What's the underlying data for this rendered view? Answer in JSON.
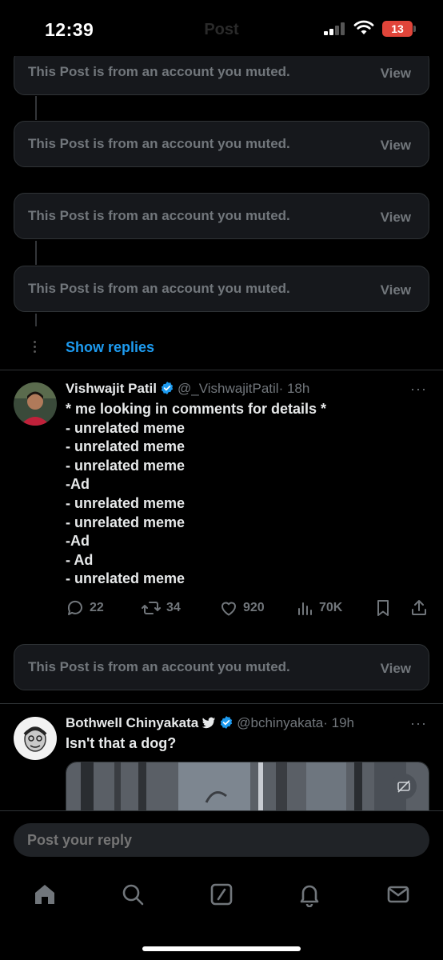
{
  "status_bar": {
    "time": "12:39",
    "title": "Post",
    "battery": "13"
  },
  "muted_cards": [
    {
      "text": "This Post is from an account you muted.",
      "view_label": "View"
    },
    {
      "text": "This Post is from an account you muted.",
      "view_label": "View"
    },
    {
      "text": "This Post is from an account you muted.",
      "view_label": "View"
    },
    {
      "text": "This Post is from an account you muted.",
      "view_label": "View"
    },
    {
      "text": "This Post is from an account you muted.",
      "view_label": "View"
    }
  ],
  "show_replies": "Show replies",
  "tweets": [
    {
      "name": "Vishwajit Patil",
      "handle": "@_VishwajitPatil",
      "time": "· 18h",
      "lines": [
        "* me looking in comments for details *",
        "- unrelated meme",
        "- unrelated meme",
        "- unrelated meme",
        "-Ad",
        "- unrelated meme",
        "- unrelated meme",
        "-Ad",
        "- Ad",
        "- unrelated meme"
      ],
      "stats": {
        "replies": "22",
        "reposts": "34",
        "likes": "920",
        "views": "70K"
      }
    },
    {
      "name": "Bothwell Chinyakata",
      "handle": "@bchinyakata",
      "time": "· 19h",
      "text": "Isn't that a dog?"
    }
  ],
  "reply_bar": {
    "placeholder": "Post your reply"
  },
  "tabs": [
    "home-icon",
    "search-icon",
    "grok-icon",
    "notifications-icon",
    "messages-icon"
  ],
  "colors": {
    "accent": "#1d9bf0",
    "muted": "#71767b",
    "background": "#000000"
  }
}
